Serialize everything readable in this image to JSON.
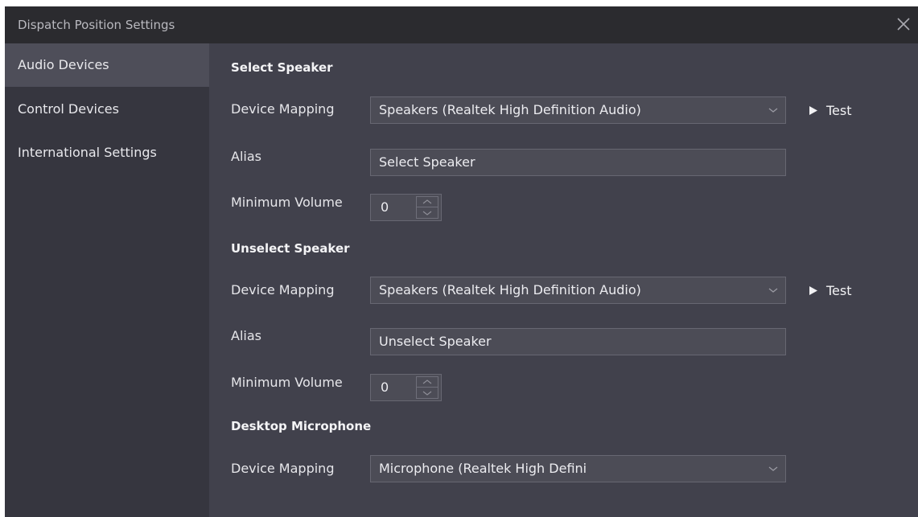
{
  "window": {
    "title": "Dispatch Position Settings"
  },
  "sidebar": {
    "items": [
      {
        "label": "Audio Devices"
      },
      {
        "label": "Control Devices"
      },
      {
        "label": "International Settings"
      }
    ]
  },
  "sections": {
    "select_speaker": {
      "title": "Select Speaker",
      "device_mapping_label": "Device Mapping",
      "device_mapping_value": "Speakers (Realtek High Definition Audio)",
      "test_label": "Test",
      "alias_label": "Alias",
      "alias_value": "Select Speaker",
      "min_volume_label": "Minimum Volume",
      "min_volume_value": "0"
    },
    "unselect_speaker": {
      "title": "Unselect Speaker",
      "device_mapping_label": "Device Mapping",
      "device_mapping_value": "Speakers (Realtek High Definition Audio)",
      "test_label": "Test",
      "alias_label": "Alias",
      "alias_value": "Unselect Speaker",
      "min_volume_label": "Minimum Volume",
      "min_volume_value": "0"
    },
    "desktop_microphone": {
      "title": "Desktop Microphone",
      "device_mapping_label": "Device Mapping",
      "device_mapping_value": "Microphone (Realtek High Defini"
    }
  },
  "icons": {
    "close": "close-icon",
    "chevron": "chevron-down-icon",
    "play": "play-icon",
    "stepper_up": "chevron-up-icon",
    "stepper_down": "chevron-down-icon"
  },
  "colors": {
    "titlebar": "#2b2b2f",
    "sidebar": "#36363f",
    "sidebar_active": "#4e4e59",
    "content": "#41414c",
    "field": "#4c4c56"
  }
}
